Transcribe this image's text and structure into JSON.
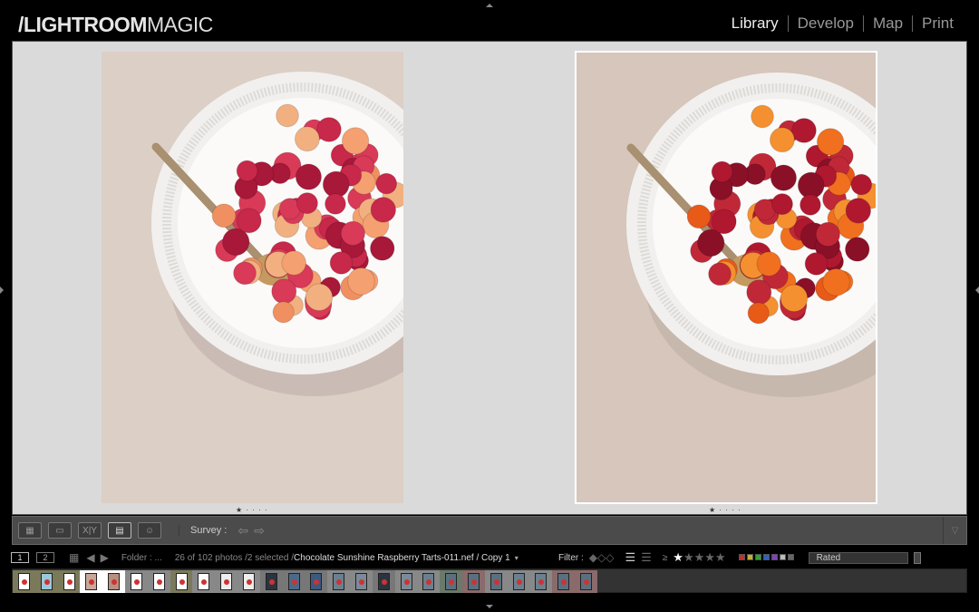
{
  "app": {
    "logo_bold": "/LIGHTROOM",
    "logo_thin": "MAGIC"
  },
  "modules": [
    {
      "label": "Library",
      "active": true
    },
    {
      "label": "Develop"
    },
    {
      "label": "Map"
    },
    {
      "label": "Print"
    }
  ],
  "main": {
    "view": "Survey",
    "photos": [
      {
        "rating_text": "★ · · · ·",
        "selected": false
      },
      {
        "rating_text": "★ · · · ·",
        "selected": true
      }
    ]
  },
  "toolbar": {
    "survey_label": "Survey :",
    "view_icons": [
      "grid-view-icon",
      "loupe-view-icon",
      "compare-view-icon",
      "survey-view-icon",
      "people-view-icon"
    ]
  },
  "filmstrip_bar": {
    "screen1": "1",
    "screen2": "2",
    "folder": "Folder : ...",
    "count": "26 of 102 photos /2 selected /",
    "filename": "Chocolate Sunshine Raspberry Tarts-011.nef / Copy 1",
    "filter_label": "Filter :",
    "rating_op": "≥",
    "stars_on": 1,
    "stars_total": 5,
    "label_colors": [
      "#c03030",
      "#c0b030",
      "#30a030",
      "#3060c0",
      "#8040c0",
      "#bbbbbb",
      "#666666"
    ],
    "filter_preset": "Rated"
  },
  "colors": {
    "accent_text": "#eeeeee",
    "main_bg": "#dadada",
    "toolbar_bg": "#4b4b4b"
  },
  "filmstrip": {
    "thumbs": [
      {
        "bg": "#7a7a5a",
        "img": "#fff"
      },
      {
        "bg": "#7a7a5a",
        "img": "#9cc8dc"
      },
      {
        "bg": "#7a7a5a",
        "img": "#fff"
      },
      {
        "bg": "#ffffff",
        "img": "#c9a89a",
        "selected": true
      },
      {
        "bg": "#ffffff",
        "img": "#b89080",
        "selected": true
      },
      {
        "bg": "#888",
        "img": "#fff"
      },
      {
        "bg": "#888",
        "img": "#fff"
      },
      {
        "bg": "#7a7a5a",
        "img": "#fff"
      },
      {
        "bg": "#888",
        "img": "#fff"
      },
      {
        "bg": "#888",
        "img": "#eee"
      },
      {
        "bg": "#888",
        "img": "#eee"
      },
      {
        "bg": "#777",
        "img": "#2a3440"
      },
      {
        "bg": "#777",
        "img": "#4a6a8a"
      },
      {
        "bg": "#777",
        "img": "#3a5a80"
      },
      {
        "bg": "#888",
        "img": "#6a8090"
      },
      {
        "bg": "#888",
        "img": "#7a8a98"
      },
      {
        "bg": "#777",
        "img": "#2a3440"
      },
      {
        "bg": "#888",
        "img": "#7a8a98"
      },
      {
        "bg": "#888",
        "img": "#6a8090"
      },
      {
        "bg": "#6a7a6a",
        "img": "#5a7080"
      },
      {
        "bg": "#8a6a6a",
        "img": "#5a7080"
      },
      {
        "bg": "#888",
        "img": "#5a7080"
      },
      {
        "bg": "#888",
        "img": "#6a8090"
      },
      {
        "bg": "#888",
        "img": "#6a8090"
      },
      {
        "bg": "#8a6a6a",
        "img": "#5a7080"
      },
      {
        "bg": "#8a6a6a",
        "img": "#5a7080"
      }
    ]
  }
}
